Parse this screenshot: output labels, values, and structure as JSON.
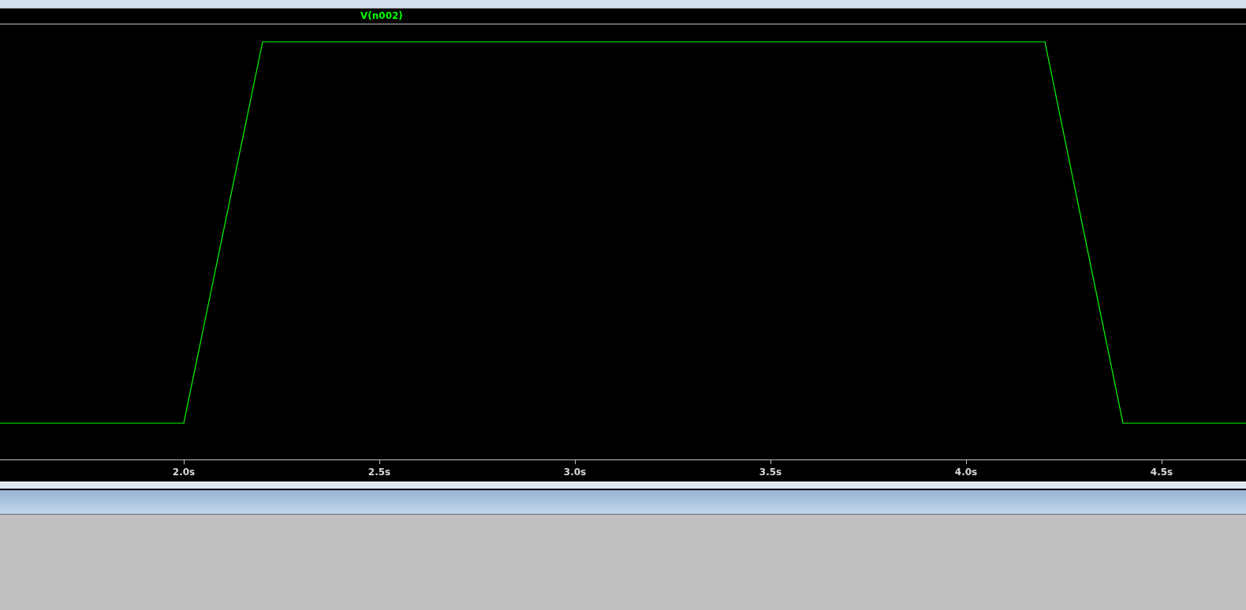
{
  "plot": {
    "trace_label": "V(n002)",
    "x_tick_labels": [
      "2.0s",
      "2.5s",
      "3.0s",
      "3.5s",
      "4.0s",
      "4.5s"
    ]
  }
}
